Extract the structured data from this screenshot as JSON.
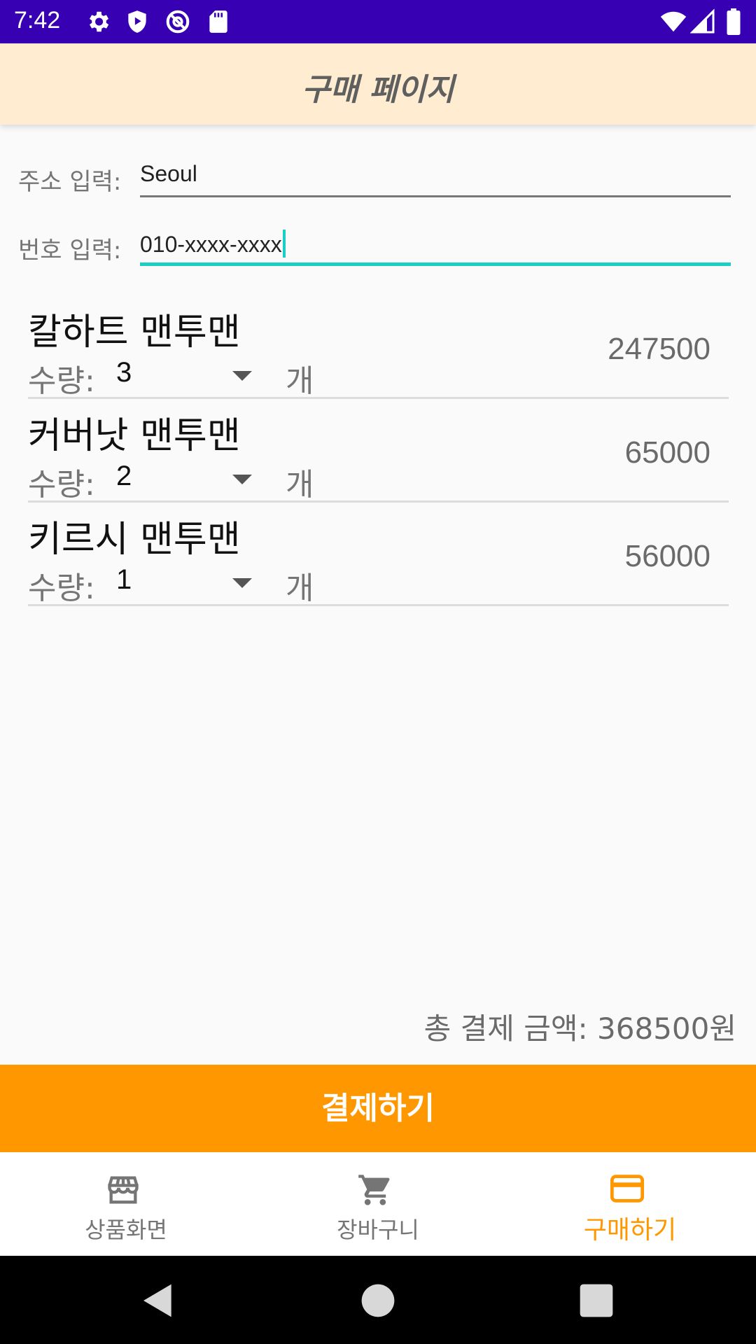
{
  "status_bar": {
    "time": "7:42"
  },
  "toolbar": {
    "title": "구매 페이지"
  },
  "address": {
    "label": "주소 입력:",
    "value": "Seoul"
  },
  "phone": {
    "label": "번호 입력:",
    "value": "010-xxxx-xxxx"
  },
  "items": [
    {
      "name": "칼하트 맨투맨",
      "qty_label": "수량:",
      "qty": "3",
      "unit": "개",
      "price": "247500"
    },
    {
      "name": "커버낫 맨투맨",
      "qty_label": "수량:",
      "qty": "2",
      "unit": "개",
      "price": "65000"
    },
    {
      "name": "키르시 맨투맨",
      "qty_label": "수량:",
      "qty": "1",
      "unit": "개",
      "price": "56000"
    }
  ],
  "total": {
    "text": "총 결제 금액: 368500원"
  },
  "pay_button": {
    "label": "결제하기"
  },
  "bottom_nav": {
    "items": [
      {
        "label": "상품화면",
        "icon": "store-icon",
        "active": false
      },
      {
        "label": "장바구니",
        "icon": "cart-icon",
        "active": false
      },
      {
        "label": "구매하기",
        "icon": "credit-card-icon",
        "active": true
      }
    ]
  },
  "colors": {
    "status_bar": "#3700b3",
    "toolbar": "#ffecd1",
    "accent": "#ff9800",
    "focus": "#1ccfc4"
  }
}
